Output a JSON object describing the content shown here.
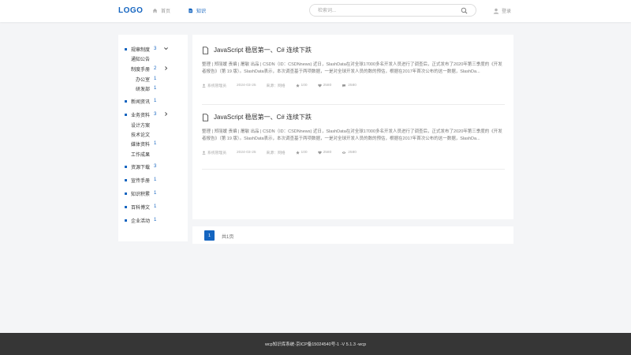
{
  "header": {
    "logo": "LOGO",
    "nav": [
      {
        "label": "首页",
        "icon": "home-icon"
      },
      {
        "label": "知识",
        "icon": "document-icon"
      }
    ],
    "search_placeholder": "检索词...",
    "login_label": "登录"
  },
  "sidebar": {
    "items": [
      {
        "label": "规章制度",
        "count": "3",
        "expanded": true
      },
      {
        "label": "通知公告"
      },
      {
        "label": "制度手册",
        "count": "2",
        "expanded": false
      },
      {
        "label": "办公室",
        "count": "1"
      },
      {
        "label": "研发部",
        "count": "1"
      },
      {
        "label": "新闻资讯",
        "count": "1"
      },
      {
        "label": "业务资料",
        "count": "3",
        "expanded": false
      },
      {
        "label": "设计方案"
      },
      {
        "label": "技术论文"
      },
      {
        "label": "媒体资料",
        "count": "1"
      },
      {
        "label": "工作成果"
      },
      {
        "label": "资源下载",
        "count": "3"
      },
      {
        "label": "宣传手册",
        "count": "1"
      },
      {
        "label": "知识积累",
        "count": "1"
      },
      {
        "label": "百科博文",
        "count": "1"
      },
      {
        "label": "企业活动",
        "count": "1"
      }
    ]
  },
  "articles": [
    {
      "title": "JavaScript 稳居第一、C# 连续下跌",
      "abstract": "整理 | 郑丽媛 责编 | 屠敏 出品 | CSDN（ID：CSDNnews) 近日，SlashData在对全球17000多名开发人员进行了调查后，正式发布了2020年第三季度的《开发者报告》（第 19 版）。SlashData表示，本次调查基于两项数据，一是对全球开发人员的数的预估，根据在2017年首次公布的这一数据，SlashDa...",
      "author": "系统管理员",
      "date": "2024-03-25",
      "source": "来源：网络",
      "stars": "100",
      "likes": "2580",
      "views": "2580"
    },
    {
      "title": "JavaScript 稳居第一、C# 连续下跌",
      "abstract": "整理 | 郑丽媛 责编 | 屠敏 出品 | CSDN（ID：CSDNnews) 近日，SlashData在对全球17000多名开发人员进行了调查后，正式发布了2020年第三季度的《开发者报告》（第 19 版）。SlashData表示，本次调查基于两项数据，一是对全球开发人员的数的预估，根据在2017年首次公布的这一数据，SlashDa...",
      "author": "系统管理员",
      "date": "2024-03-25",
      "source": "来源：网络",
      "stars": "100",
      "likes": "2580",
      "views": "2580"
    }
  ],
  "pager": {
    "current": "1",
    "total": "共1页"
  },
  "footer": {
    "text": "wcp知识库系统-京ICP备15024540号-1 -V 5.1.3 -wcp"
  },
  "colors": {
    "accent": "#1565c0",
    "footer_bg": "#363636"
  }
}
